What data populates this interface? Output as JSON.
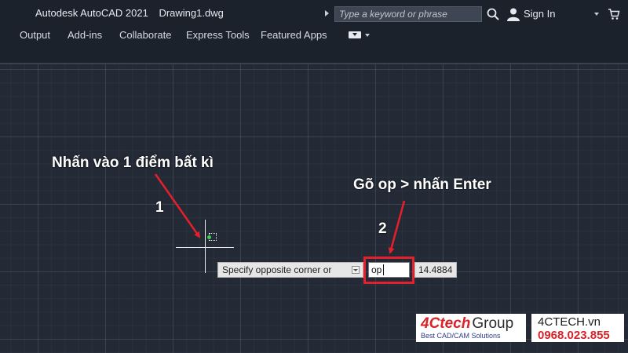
{
  "titlebar": {
    "app_name": "Autodesk AutoCAD 2021",
    "document": "Drawing1.dwg",
    "search_placeholder": "Type a keyword or phrase",
    "sign_in": "Sign In"
  },
  "ribbon": {
    "tabs": [
      "Output",
      "Add-ins",
      "Collaborate",
      "Express Tools",
      "Featured Apps"
    ]
  },
  "command": {
    "prompt": "Specify opposite corner or",
    "input_value": "op",
    "coordinate": "14.4884"
  },
  "annotations": {
    "step1_text": "Nhấn vào 1 điểm bất kì",
    "step1_number": "1",
    "step2_text": "Gõ op > nhấn Enter",
    "step2_number": "2",
    "highlight_color": "#e3202b"
  },
  "watermark": {
    "brand": "4Ctech",
    "brand_suffix": "Group",
    "tagline": "Best CAD/CAM Solutions",
    "website": "4CTECH.vn",
    "phone": "0968.023.855"
  },
  "icons": [
    "search-icon",
    "user-icon",
    "cart-icon",
    "chevron-down-icon",
    "crosshair-cursor"
  ]
}
